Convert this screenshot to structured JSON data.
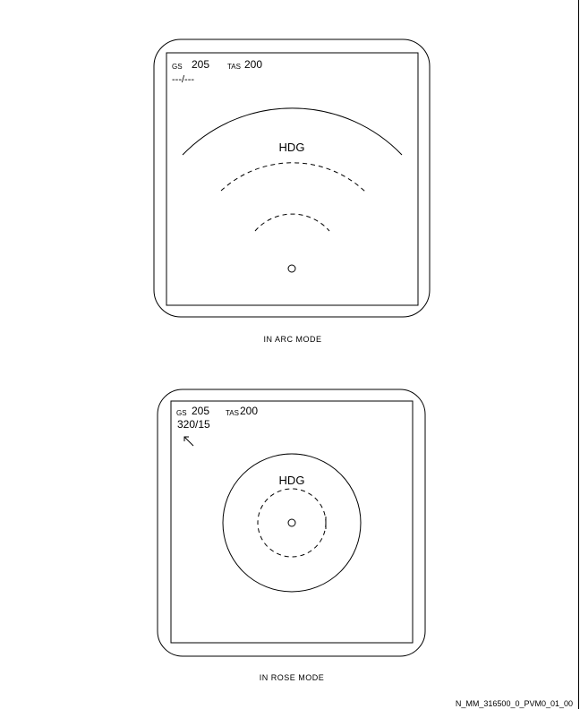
{
  "arc_display": {
    "gs_label": "GS",
    "gs_value": "205",
    "tas_label": "TAS",
    "tas_value": "200",
    "wind": "---/---",
    "heading_label": "HDG",
    "caption": "IN ARC MODE"
  },
  "rose_display": {
    "gs_label": "GS",
    "gs_value": "205",
    "tas_label": "TAS",
    "tas_value": "200",
    "wind": "320/15",
    "wind_arrow_icon": "wind-arrow-icon",
    "heading_label": "HDG",
    "caption": "IN ROSE MODE"
  },
  "figure_id": "N_MM_316500_0_PVM0_01_00"
}
